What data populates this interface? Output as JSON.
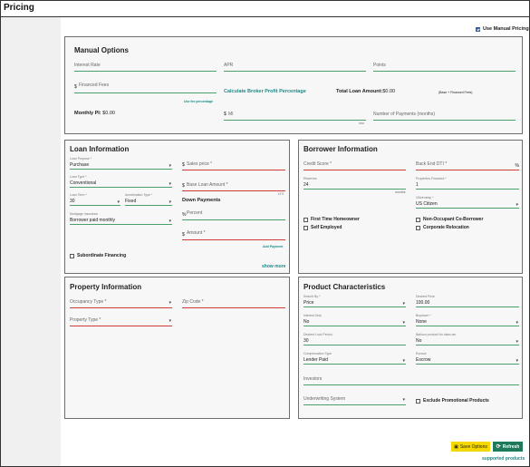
{
  "page": {
    "title": "Pricing"
  },
  "use_manual_pricing": {
    "label": "Use Manual Pricing",
    "checked": true
  },
  "manual_options": {
    "title": "Manual Options",
    "interest_rate": "Interest Rate",
    "apr": "APR",
    "points": "Points",
    "financed_fees_prefix": "$",
    "financed_fees": "Financed Fees",
    "calc_link": "Calculate Broker Profit Percentage",
    "total_loan_label": "Total Loan Amount:",
    "total_loan_value": "$0.00",
    "base_note": "(Base + Financed Fees)",
    "use_fee_pct": "Use fee percentage",
    "monthly_pi_label": "Monthly PI:",
    "monthly_pi_value": "$0.00",
    "mi_prefix": "$",
    "mi": "MI",
    "mi_unit": "/mo",
    "num_payments": "Number of Payments (months)"
  },
  "loan_info": {
    "title": "Loan Information",
    "loan_purpose_label": "Loan Purpose *",
    "loan_purpose": "Purchase",
    "sales_price": "Sales price *",
    "loan_type_label": "Loan Type *",
    "loan_type": "Conventional",
    "base_loan": "Base Loan Amount *",
    "ltv": "LTV",
    "loan_term_label": "Loan Term *",
    "loan_term": "30",
    "amort_label": "Amortization Type *",
    "amort": "Fixed",
    "down_payments": "Down Payments",
    "mortgage_ins_label": "Mortgage Insurance",
    "mortgage_ins": "Borrower paid monthly",
    "percent": "Percent",
    "percent_prefix": "%",
    "amount": "Amount *",
    "amount_prefix": "$",
    "add_payment": "Add Payment",
    "subordinate": "Subordinate Financing",
    "show_more": "show more",
    "currency_prefix": "$"
  },
  "borrower_info": {
    "title": "Borrower Information",
    "credit_score": "Credit Score *",
    "back_end_dti": "Back End DTI *",
    "pct": "%",
    "reserves_label": "Reserves",
    "reserves": "24",
    "months": "months",
    "properties_label": "Properties Financed *",
    "properties": "1",
    "citizenship_label": "Citizenship *",
    "citizenship": "US Citizen",
    "first_time": "First Time Homeowner",
    "non_occupant": "Non-Occupant Co-Borrower",
    "self_employed": "Self Employed",
    "corporate": "Corporate Relocation"
  },
  "property_info": {
    "title": "Property Information",
    "occupancy": "Occupancy Type *",
    "zip": "Zip Code *",
    "property_type": "Property Type *"
  },
  "product_chars": {
    "title": "Product Characteristics",
    "search_by_label": "Search By *",
    "search_by": "Price",
    "desired_price_label": "Desired Price",
    "desired_price": "100.00",
    "interest_only_label": "Interest Only",
    "interest_only": "No",
    "buydown_label": "Buydown *",
    "buydown": "None",
    "lock_period_label": "Desired Lock Period",
    "lock_period": "30",
    "balloon_label": "Balloon product No data use",
    "balloon": "No",
    "comp_type_label": "Compensation Type",
    "comp_type": "Lender Paid",
    "escrow_label": "Escrow",
    "escrow": "Escrow",
    "investors": "Investors",
    "underwriting": "Underwriting System",
    "exclude_promo": "Exclude Promotional Products"
  },
  "actions": {
    "save_options": "Save Options",
    "refresh": "Refresh",
    "supported_products": "supported products"
  }
}
